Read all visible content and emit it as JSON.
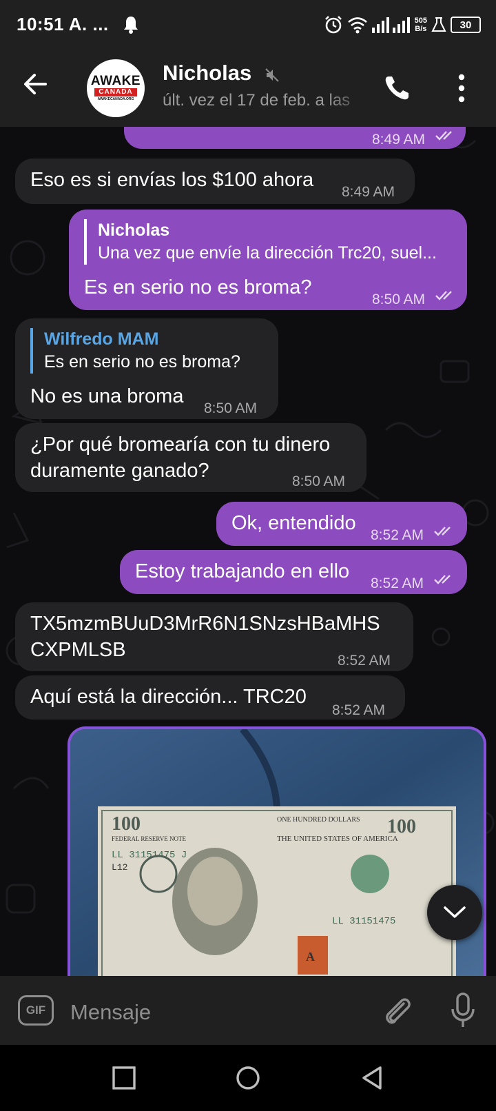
{
  "status_bar": {
    "time": "10:51 A. ...",
    "net_speed_value": "505",
    "net_speed_unit": "B/s",
    "battery": "30"
  },
  "header": {
    "contact_name": "Nicholas",
    "last_seen": "últ. vez el 17 de feb. a las",
    "avatar_line1": "AWAKE",
    "avatar_line2": "CANADA",
    "avatar_line3": "AWAKECANADA.ORG"
  },
  "messages": [
    {
      "id": "m0",
      "direction": "out",
      "text": "",
      "time": "8:49 AM",
      "read": true
    },
    {
      "id": "m1",
      "direction": "in",
      "text": "Eso es si envías los $100 ahora",
      "time": "8:49 AM"
    },
    {
      "id": "m2",
      "direction": "out",
      "reply_to_name": "Nicholas",
      "reply_to_text": "Una vez que envíe la dirección Trc20, suel...",
      "text": "Es en serio no es broma?",
      "time": "8:50 AM",
      "read": true
    },
    {
      "id": "m3",
      "direction": "in",
      "reply_to_name": "Wilfredo MAM",
      "reply_to_text": "Es en serio no es broma?",
      "text": "No es una broma",
      "time": "8:50 AM"
    },
    {
      "id": "m4",
      "direction": "in",
      "text_line1": "¿Por qué bromearía con tu dinero",
      "text_line2": "duramente ganado?",
      "time": "8:50 AM"
    },
    {
      "id": "m5",
      "direction": "out",
      "text": "Ok, entendido",
      "time": "8:52 AM",
      "read": true
    },
    {
      "id": "m6",
      "direction": "out",
      "text": "Estoy trabajando en ello",
      "time": "8:52 AM",
      "read": true
    },
    {
      "id": "m7",
      "direction": "in",
      "text_line1": "TX5mzmBUuD3MrR6N1SNzsHBaMHS",
      "text_line2": "CXPMLSB",
      "time": "8:52 AM"
    },
    {
      "id": "m8",
      "direction": "in",
      "text": "Aquí está la dirección... TRC20",
      "time": "8:52 AM"
    }
  ],
  "photo": {
    "bill_denomination": "100",
    "bill_serial": "LL 31151475 J",
    "bill_serial_short": "LL 31151475",
    "bill_code": "L12",
    "bill_country": "THE UNITED STATES OF AMERICA",
    "bill_note": "FEDERAL RESERVE NOTE",
    "bill_top": "ONE HUNDRED DOLLARS",
    "bill_letter": "A"
  },
  "input": {
    "gif_label": "GIF",
    "placeholder": "Mensaje"
  },
  "colors": {
    "outgoing_bubble": "#8c4bbf",
    "incoming_bubble": "#232325",
    "reply_accent_in": "#58a6e6",
    "background": "#0d0d0f"
  }
}
